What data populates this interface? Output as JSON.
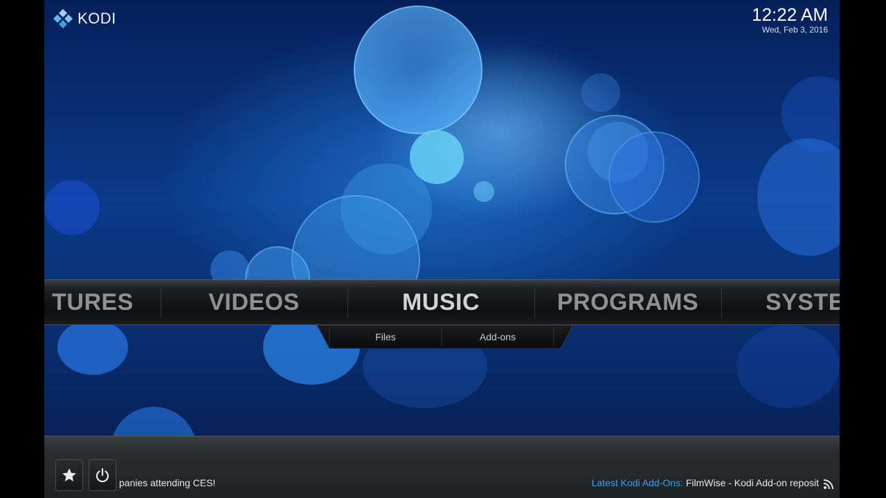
{
  "app": {
    "name": "KODI"
  },
  "clock": {
    "time": "12:22 AM",
    "date": "Wed, Feb 3, 2016"
  },
  "main_menu": {
    "items": [
      {
        "label": "TURES",
        "active": false
      },
      {
        "label": "VIDEOS",
        "active": false
      },
      {
        "label": "MUSIC",
        "active": true
      },
      {
        "label": "PROGRAMS",
        "active": false
      },
      {
        "label": "SYSTE",
        "active": false
      }
    ]
  },
  "submenu": {
    "items": [
      {
        "label": "Files"
      },
      {
        "label": "Add-ons"
      }
    ]
  },
  "footer": {
    "favourites_icon": "star-icon",
    "power_icon": "power-icon",
    "ticker_text": "panies attending CES!",
    "rss_title": "Latest Kodi Add-Ons:",
    "rss_text": "FilmWise - Kodi Add-on reposit",
    "rss_icon": "rss-icon"
  },
  "colors": {
    "accent": "#3aa0e8",
    "menu_active": "#cfd3d6",
    "menu_inactive": "#8d9297"
  }
}
